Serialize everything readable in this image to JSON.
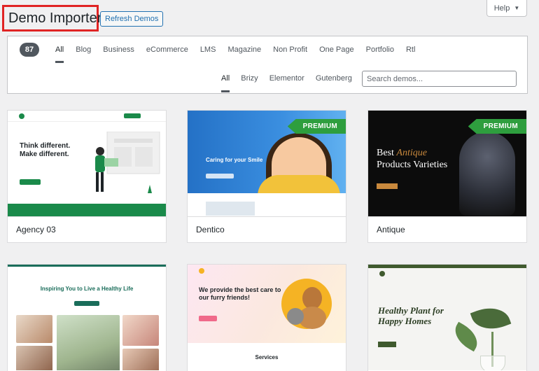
{
  "header": {
    "title": "Demo Importer",
    "refresh_label": "Refresh Demos",
    "help_label": "Help"
  },
  "filters": {
    "count": "87",
    "categories": [
      "All",
      "Blog",
      "Business",
      "eCommerce",
      "LMS",
      "Magazine",
      "Non Profit",
      "One Page",
      "Portfolio",
      "Rtl"
    ],
    "active_category": "All",
    "builders": [
      "All",
      "Brizy",
      "Elementor",
      "Gutenberg"
    ],
    "active_builder": "All",
    "search_placeholder": "Search demos..."
  },
  "demos": [
    {
      "name": "Agency 03",
      "premium": false,
      "headline": "Think different. Make different."
    },
    {
      "name": "Dentico",
      "premium": true,
      "badge": "PREMIUM",
      "headline": "Caring for your Smile"
    },
    {
      "name": "Antique",
      "premium": true,
      "badge": "PREMIUM",
      "headline_pre": "Best ",
      "headline_em": "Antique",
      "headline_post": "Products Varieties"
    },
    {
      "name": "",
      "premium": false,
      "headline": "Inspiring You to Live a Healthy Life"
    },
    {
      "name": "",
      "premium": false,
      "headline": "We provide the best care to our furry friends!",
      "section": "Services"
    },
    {
      "name": "",
      "premium": false,
      "headline": "Healthy Plant for Happy Homes"
    }
  ],
  "colors": {
    "accent": "#2271b1",
    "highlight_border": "#e02424",
    "premium_ribbon": "#2e9e3e"
  }
}
